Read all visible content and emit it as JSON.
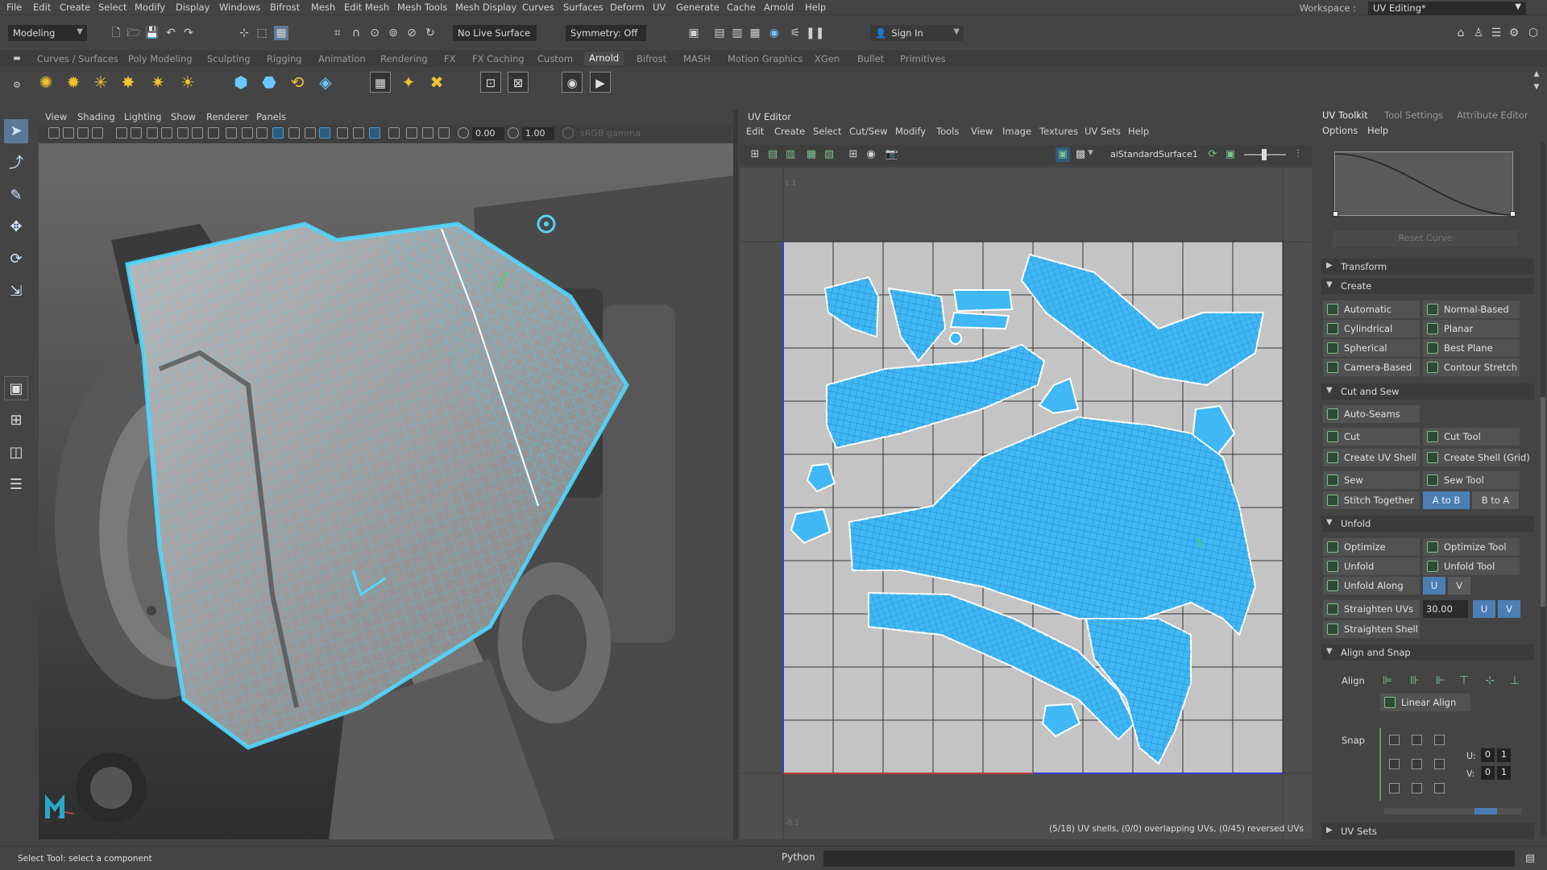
{
  "menubar": {
    "items": [
      "File",
      "Edit",
      "Create",
      "Select",
      "Modify",
      "Display",
      "Windows",
      "Bifrost",
      "Mesh",
      "Edit Mesh",
      "Mesh Tools",
      "Mesh Display",
      "Curves",
      "Surfaces",
      "Deform",
      "UV",
      "Generate",
      "Cache",
      "Arnold",
      "Help"
    ],
    "workspace_label": "Workspace :",
    "workspace_value": "UV Editing*"
  },
  "statusline": {
    "mode": "Modeling",
    "live_surface": "No Live Surface",
    "symmetry": "Symmetry: Off",
    "sign_in": "Sign In"
  },
  "shelf": {
    "tabs": [
      "Curves / Surfaces",
      "Poly Modeling",
      "Sculpting",
      "Rigging",
      "Animation",
      "Rendering",
      "FX",
      "FX Caching",
      "Custom",
      "Arnold",
      "Bifrost",
      "MASH",
      "Motion Graphics",
      "XGen",
      "Bullet",
      "Primitives"
    ],
    "active_tab": "Arnold"
  },
  "viewport": {
    "menu": [
      "View",
      "Shading",
      "Lighting",
      "Show",
      "Renderer",
      "Panels"
    ],
    "exposure": "0.00",
    "gamma": "1.00",
    "color_space": "sRGB gamma"
  },
  "uv_editor": {
    "title": "UV Editor",
    "menu": [
      "Edit",
      "Create",
      "Select",
      "Cut/Sew",
      "Modify",
      "Tools",
      "View",
      "Image",
      "Textures",
      "UV Sets",
      "Help"
    ],
    "material": "aiStandardSurface1",
    "status": "(5/18) UV shells, (0/0) overlapping UVs, (0/45) reversed UVs",
    "axis_top": "1.1",
    "axis_bottom": "-0.1"
  },
  "uv_toolkit": {
    "tabs": [
      "UV Toolkit",
      "Tool Settings",
      "Attribute Editor"
    ],
    "menu": [
      "Options",
      "Help"
    ],
    "reset_curve": "Reset Curve",
    "sections": {
      "transform": "Transform",
      "create": "Create",
      "cut_and_sew": "Cut and Sew",
      "unfold": "Unfold",
      "align_and_snap": "Align and Snap",
      "uv_sets": "UV Sets"
    },
    "create_buttons": [
      "Automatic",
      "Normal-Based",
      "Cylindrical",
      "Planar",
      "Spherical",
      "Best Plane",
      "Camera-Based",
      "Contour Stretch"
    ],
    "cut_buttons": {
      "auto_seams": "Auto-Seams",
      "cut": "Cut",
      "cut_tool": "Cut Tool",
      "create_uv_shell": "Create UV Shell",
      "create_shell_grid": "Create Shell (Grid)",
      "sew": "Sew",
      "sew_tool": "Sew Tool",
      "stitch_together": "Stitch Together",
      "a_to_b": "A to B",
      "b_to_a": "B to A"
    },
    "unfold_buttons": {
      "optimize": "Optimize",
      "optimize_tool": "Optimize Tool",
      "unfold": "Unfold",
      "unfold_tool": "Unfold Tool",
      "unfold_along": "Unfold Along",
      "u": "U",
      "v": "V",
      "straighten_uvs": "Straighten UVs",
      "straighten_value": "30.00",
      "straighten_shell": "Straighten Shell"
    },
    "align": {
      "align_label": "Align",
      "linear_align": "Linear Align",
      "snap_label": "Snap",
      "u_label": "U:",
      "v_label": "V:",
      "u0": "0",
      "u1": "1",
      "v0": "0",
      "v1": "1"
    }
  },
  "helpline": {
    "text": "Select Tool: select a component",
    "python": "Python"
  },
  "colors": {
    "wire": "#3fd0ff",
    "accent_blue": "#4b7fb3",
    "maya_logo": "#2aa7c9"
  }
}
